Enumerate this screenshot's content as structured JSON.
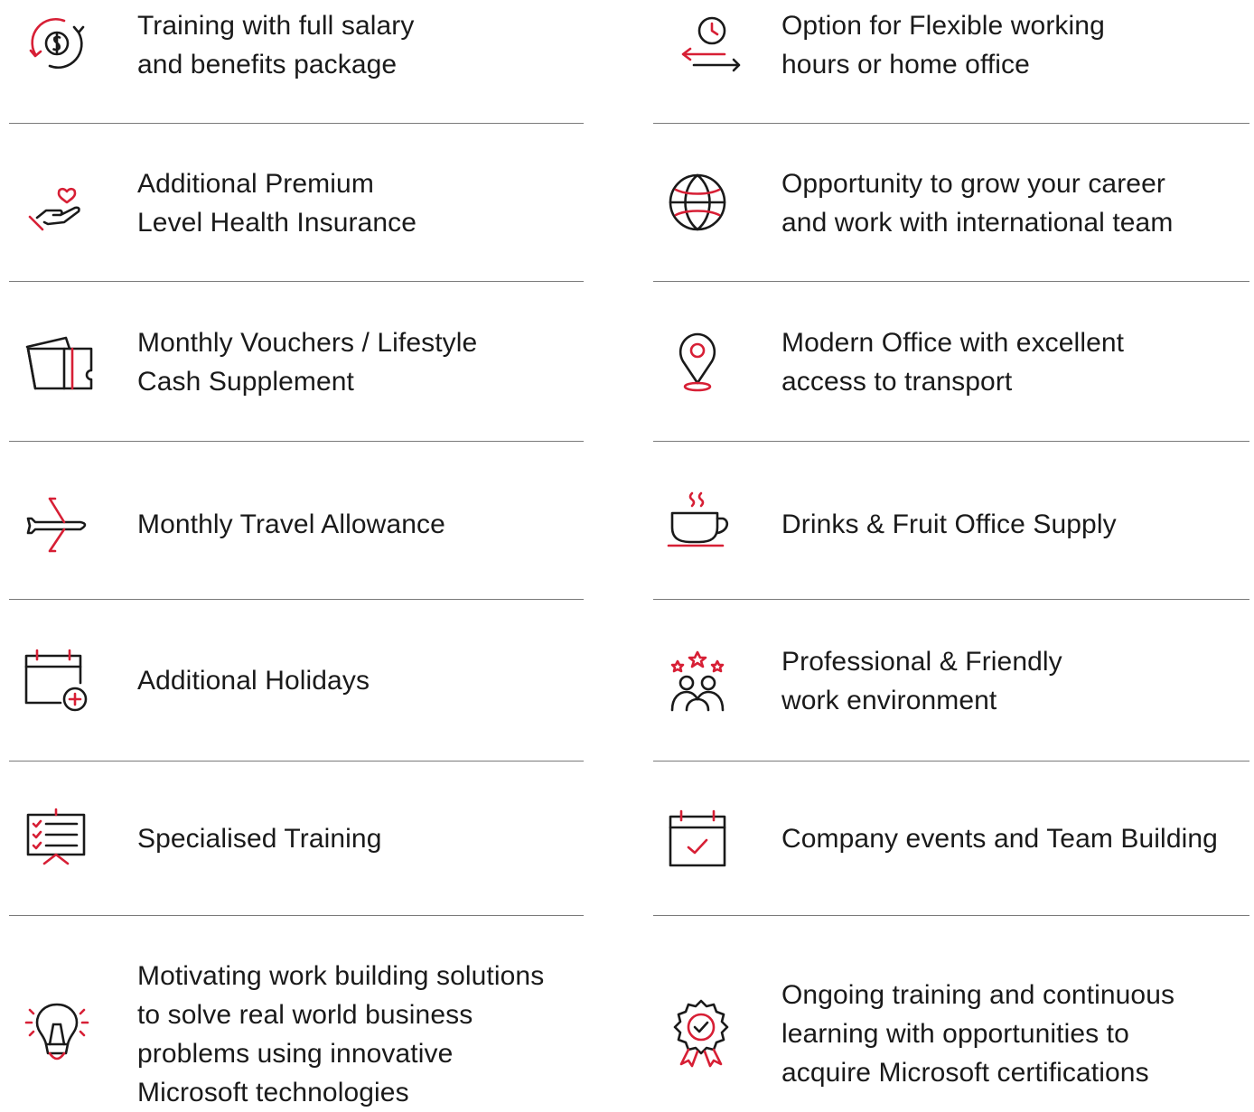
{
  "colors": {
    "text": "#1a1a1a",
    "accent": "#d71f35",
    "divider": "#7a7a7a"
  },
  "benefits_left": [
    {
      "icon": "salary-cycle-icon",
      "text": "Training with full salary\nand benefits package"
    },
    {
      "icon": "hand-heart-icon",
      "text": "Additional Premium\nLevel Health Insurance"
    },
    {
      "icon": "voucher-ticket-icon",
      "text": "Monthly Vouchers / Lifestyle\nCash Supplement"
    },
    {
      "icon": "airplane-icon",
      "text": "Monthly Travel Allowance"
    },
    {
      "icon": "calendar-plus-icon",
      "text": "Additional Holidays"
    },
    {
      "icon": "presentation-checklist-icon",
      "text": "Specialised Training"
    },
    {
      "icon": "lightbulb-icon",
      "text": "Motivating work building solutions\nto solve real world business\nproblems using innovative\nMicrosoft technologies"
    }
  ],
  "benefits_right": [
    {
      "icon": "clock-arrows-icon",
      "text": "Option for Flexible working\nhours or home office"
    },
    {
      "icon": "globe-icon",
      "text": "Opportunity to grow your career\nand work with international team"
    },
    {
      "icon": "location-pin-icon",
      "text": "Modern Office with excellent\naccess to transport"
    },
    {
      "icon": "coffee-cup-icon",
      "text": "Drinks & Fruit Office Supply"
    },
    {
      "icon": "team-stars-icon",
      "text": "Professional & Friendly\nwork environment"
    },
    {
      "icon": "calendar-check-icon",
      "text": "Company events and Team Building"
    },
    {
      "icon": "certificate-badge-icon",
      "text": "Ongoing training and continuous\nlearning with opportunities to\nacquire Microsoft certifications"
    }
  ]
}
